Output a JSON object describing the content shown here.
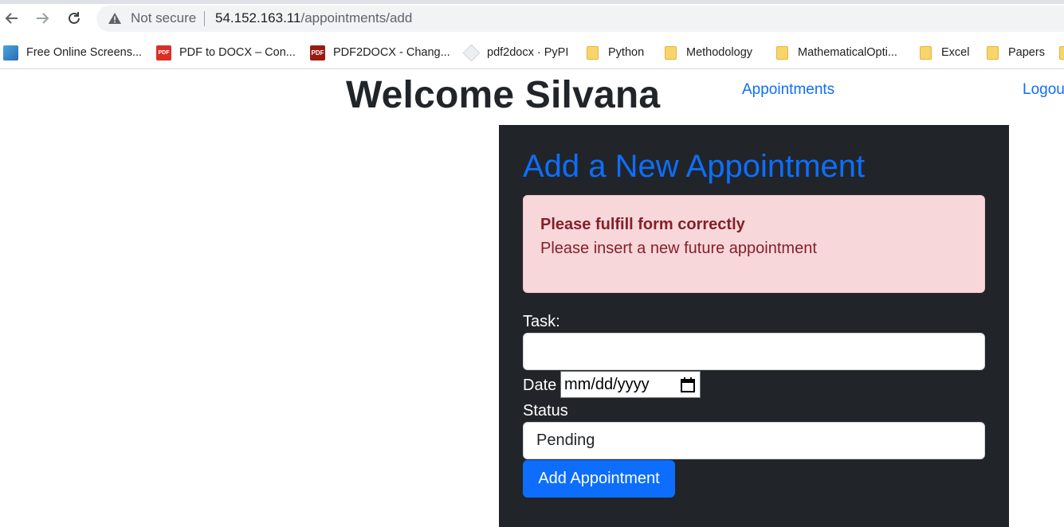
{
  "browser": {
    "security_label": "Not secure",
    "url_host": "54.152.163.11",
    "url_path": "/appointments/add",
    "bookmarks": [
      {
        "label": "Free Online Screens...",
        "icon": "screenshot-icon"
      },
      {
        "label": "PDF to DOCX – Con...",
        "icon": "pdf-icon",
        "icon_text": "PDF"
      },
      {
        "label": "PDF2DOCX - Chang...",
        "icon": "pdf-icon",
        "icon_text": "PDF"
      },
      {
        "label": "pdf2docx · PyPI",
        "icon": "pypi-icon"
      },
      {
        "label": "Python",
        "icon": "folder-icon"
      },
      {
        "label": "Methodology",
        "icon": "folder-icon"
      },
      {
        "label": "MathematicalOpti...",
        "icon": "folder-icon"
      },
      {
        "label": "Excel",
        "icon": "folder-icon"
      },
      {
        "label": "Papers",
        "icon": "folder-icon"
      }
    ]
  },
  "header": {
    "welcome": "Welcome Silvana",
    "nav": {
      "appointments": "Appointments",
      "logout": "Logout"
    }
  },
  "form": {
    "title": "Add a New Appointment",
    "alert": {
      "title": "Please fulfill form correctly",
      "message": "Please insert a new future appointment"
    },
    "task_label": "Task:",
    "task_value": "",
    "date_label": "Date",
    "date_placeholder": "mm/dd/yyyy",
    "status_label": "Status",
    "status_value": "Pending",
    "submit": "Add Appointment"
  },
  "colors": {
    "accent": "#0d6efd",
    "card_bg": "#212529",
    "alert_bg": "#f8d7da",
    "alert_text": "#842029"
  }
}
